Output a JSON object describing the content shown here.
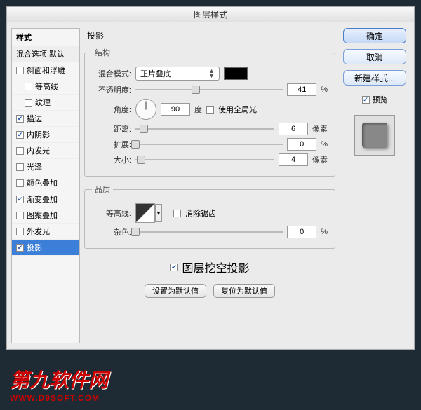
{
  "dialog_title": "图层样式",
  "sidebar": {
    "header": "样式",
    "sub": "混合选项:默认",
    "items": [
      {
        "label": "斜面和浮雕",
        "checked": false,
        "indent": false
      },
      {
        "label": "等高线",
        "checked": false,
        "indent": true
      },
      {
        "label": "纹理",
        "checked": false,
        "indent": true
      },
      {
        "label": "描边",
        "checked": true,
        "indent": false
      },
      {
        "label": "内阴影",
        "checked": true,
        "indent": false
      },
      {
        "label": "内发光",
        "checked": false,
        "indent": false
      },
      {
        "label": "光泽",
        "checked": false,
        "indent": false
      },
      {
        "label": "颜色叠加",
        "checked": false,
        "indent": false
      },
      {
        "label": "渐变叠加",
        "checked": true,
        "indent": false
      },
      {
        "label": "图案叠加",
        "checked": false,
        "indent": false
      },
      {
        "label": "外发光",
        "checked": false,
        "indent": false
      },
      {
        "label": "投影",
        "checked": true,
        "indent": false,
        "selected": true
      }
    ]
  },
  "main": {
    "title": "投影",
    "structure": {
      "legend": "结构",
      "blend_label": "混合模式:",
      "blend_value": "正片叠底",
      "opacity_label": "不透明度:",
      "opacity_value": "41",
      "opacity_unit": "%",
      "angle_label": "角度:",
      "angle_value": "90",
      "angle_unit": "度",
      "global_light": "使用全局光",
      "distance_label": "距离:",
      "distance_value": "6",
      "distance_unit": "像素",
      "spread_label": "扩展:",
      "spread_value": "0",
      "spread_unit": "%",
      "size_label": "大小:",
      "size_value": "4",
      "size_unit": "像素"
    },
    "quality": {
      "legend": "品质",
      "contour_label": "等高线:",
      "antialias": "消除锯齿",
      "noise_label": "杂色:",
      "noise_value": "0",
      "noise_unit": "%"
    },
    "knockout": "图层挖空投影",
    "set_default": "设置为默认值",
    "reset_default": "复位为默认值"
  },
  "buttons": {
    "ok": "确定",
    "cancel": "取消",
    "new_style": "新建样式...",
    "preview": "预览"
  },
  "watermark": {
    "line1": "第九软件网",
    "line2": "WWW.D9SOFT.COM"
  }
}
